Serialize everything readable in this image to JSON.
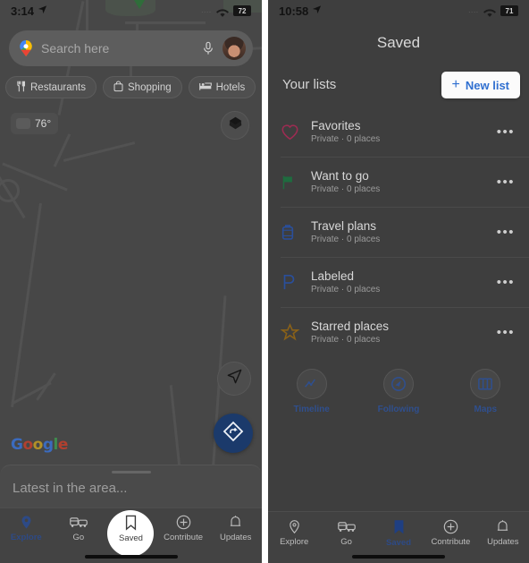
{
  "left_phone": {
    "status_bar": {
      "time": "3:14",
      "location_icon": "location-arrow-icon",
      "signal_dots": "....",
      "wifi_icon": "wifi-icon",
      "battery": "72"
    },
    "search": {
      "placeholder": "Search here",
      "logo_icon": "google-maps-pin-icon",
      "mic_icon": "microphone-icon",
      "avatar_icon": "user-avatar"
    },
    "chips": [
      {
        "label": "Restaurants",
        "icon": "restaurant-icon"
      },
      {
        "label": "Shopping",
        "icon": "shopping-bag-icon"
      },
      {
        "label": "Hotels",
        "icon": "hotel-bed-icon"
      },
      {
        "label": "",
        "icon": "more-chip-icon"
      }
    ],
    "weather": {
      "temp": "76°",
      "icon": "cloud-icon"
    },
    "map_controls": {
      "layers_icon": "layers-icon",
      "locate_icon": "navigate-arrow-icon",
      "directions_icon": "directions-diamond-icon"
    },
    "brand": {
      "g1": "G",
      "o1": "o",
      "o2": "o",
      "g2": "g",
      "l": "l",
      "e": "e"
    },
    "sheet": {
      "label": "Latest in the area..."
    },
    "bottom_nav": [
      {
        "label": "Explore",
        "icon": "pin-icon",
        "state": "active"
      },
      {
        "label": "Go",
        "icon": "transit-icon",
        "state": "inactive"
      },
      {
        "label": "Saved",
        "icon": "bookmark-icon",
        "state": "spotlight"
      },
      {
        "label": "Contribute",
        "icon": "plus-circle-icon",
        "state": "inactive"
      },
      {
        "label": "Updates",
        "icon": "bell-icon",
        "state": "inactive"
      }
    ]
  },
  "right_phone": {
    "status_bar": {
      "time": "10:58",
      "location_icon": "location-arrow-icon",
      "signal_dots": "....",
      "wifi_icon": "wifi-icon",
      "battery": "71"
    },
    "title": "Saved",
    "section_label": "Your lists",
    "new_list_button": {
      "label": "New list",
      "plus": "+",
      "icon": "plus-icon"
    },
    "lists": [
      {
        "name": "Favorites",
        "meta": "Private · 0 places",
        "icon": "heart-icon",
        "color": "#9e2b52",
        "menu": "•••"
      },
      {
        "name": "Want to go",
        "meta": "Private · 0 places",
        "icon": "flag-icon",
        "color": "#1f6b3f",
        "menu": "•••"
      },
      {
        "name": "Travel plans",
        "meta": "Private · 0 places",
        "icon": "suitcase-icon",
        "color": "#2a4f9b",
        "menu": "•••"
      },
      {
        "name": "Labeled",
        "meta": "Private · 0 places",
        "icon": "label-p-icon",
        "color": "#2a4f9b",
        "menu": "•••"
      },
      {
        "name": "Starred places",
        "meta": "Private · 0 places",
        "icon": "star-icon",
        "color": "#8a6118",
        "menu": "•••"
      }
    ],
    "actions": [
      {
        "label": "Timeline",
        "icon": "timeline-icon"
      },
      {
        "label": "Following",
        "icon": "following-icon"
      },
      {
        "label": "Maps",
        "icon": "map-icon"
      }
    ],
    "bottom_nav": [
      {
        "label": "Explore",
        "icon": "pin-icon",
        "state": "inactive"
      },
      {
        "label": "Go",
        "icon": "transit-icon",
        "state": "inactive"
      },
      {
        "label": "Saved",
        "icon": "bookmark-filled-icon",
        "state": "active"
      },
      {
        "label": "Contribute",
        "icon": "plus-circle-icon",
        "state": "inactive"
      },
      {
        "label": "Updates",
        "icon": "bell-icon",
        "state": "inactive"
      }
    ]
  },
  "colors": {
    "accent_blue": "#2f6fd0",
    "nav_active": "#2d4a86",
    "map_bg": "#474747",
    "panel_bg": "#3e3e3e"
  }
}
